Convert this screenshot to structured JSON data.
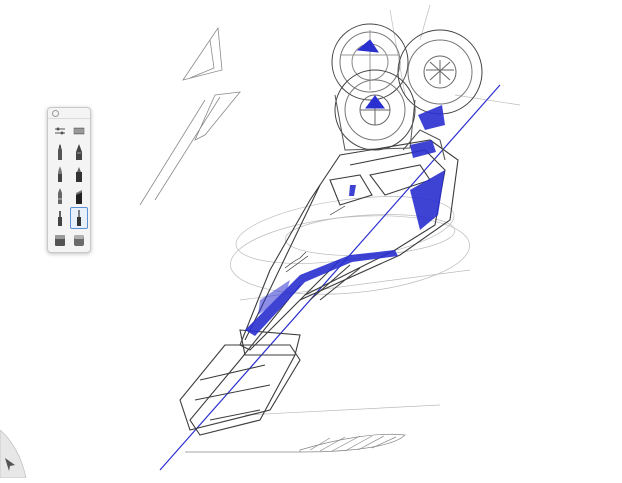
{
  "app": {
    "canvas_background": "#ffffff",
    "accent_color": "#2a2fd0"
  },
  "palette": {
    "top_icons": [
      "settings-sliders-icon",
      "brush-library-icon"
    ],
    "brushes": [
      {
        "icon": "pencil-icon",
        "selected": false
      },
      {
        "icon": "ballpoint-pen-icon",
        "selected": false
      },
      {
        "icon": "paint-brush-icon",
        "selected": false
      },
      {
        "icon": "marker-icon",
        "selected": false
      },
      {
        "icon": "airbrush-icon",
        "selected": false
      },
      {
        "icon": "chisel-marker-icon",
        "selected": false
      },
      {
        "icon": "fineliner-icon",
        "selected": false
      },
      {
        "icon": "technical-pen-icon",
        "selected": true
      },
      {
        "icon": "eraser-icon",
        "selected": false
      },
      {
        "icon": "soft-eraser-icon",
        "selected": false
      }
    ]
  },
  "corner_tool": {
    "icon": "corner-menu-icon"
  }
}
